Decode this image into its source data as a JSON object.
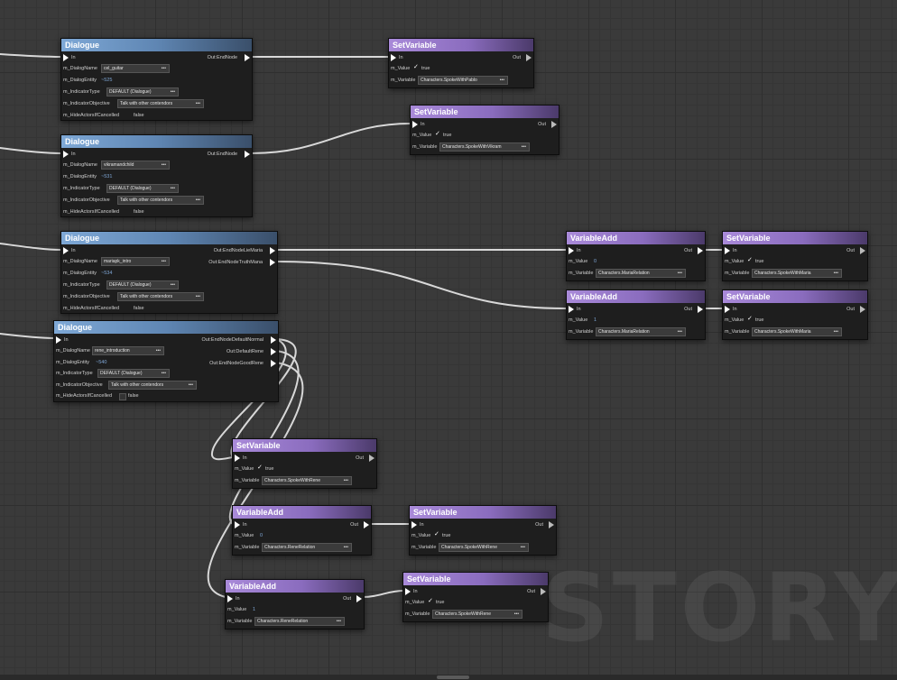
{
  "watermark": "STORY",
  "colors": {
    "dialogue_header": "#7ea8d6",
    "setvariable_header": "#a98ad9",
    "wire": "#d8d8d8",
    "canvas_bg": "#3a3a3a",
    "number_value": "#7fa7d6"
  },
  "icons": {
    "exec_pin": "triangle-pin",
    "checkbox": "check-icon"
  },
  "dialogue_nodes": [
    {
      "title": "Dialogue",
      "in_label": "In",
      "outputs": [
        "Out:EndNode"
      ],
      "dialog_name_label": "m_DialogName",
      "dialog_name": "cel_guitar",
      "dialog_entity_label": "m_DialogEntity",
      "dialog_entity": "~525",
      "indicator_type_label": "m_IndicatorType",
      "indicator_type": "DEFAULT (Dialogue)",
      "indicator_objective_label": "m_IndicatorObjective",
      "indicator_objective": "Talk with other contendors",
      "hide_actors_label": "m_HideActorsIfCancelled",
      "hide_actors": "false"
    },
    {
      "title": "Dialogue",
      "in_label": "In",
      "outputs": [
        "Out:EndNode"
      ],
      "dialog_name_label": "m_DialogName",
      "dialog_name": "vikramandchild",
      "dialog_entity_label": "m_DialogEntity",
      "dialog_entity": "~531",
      "indicator_type_label": "m_IndicatorType",
      "indicator_type": "DEFAULT (Dialogue)",
      "indicator_objective_label": "m_IndicatorObjective",
      "indicator_objective": "Talk with other contendors",
      "hide_actors_label": "m_HideActorsIfCancelled",
      "hide_actors": "false"
    },
    {
      "title": "Dialogue",
      "in_label": "In",
      "outputs": [
        "Out:EndNodeLieMaria",
        "Out:EndNodeTruthMana"
      ],
      "dialog_name_label": "m_DialogName",
      "dialog_name": "mariapk_intro",
      "dialog_entity_label": "m_DialogEntity",
      "dialog_entity": "~534",
      "indicator_type_label": "m_IndicatorType",
      "indicator_type": "DEFAULT (Dialogue)",
      "indicator_objective_label": "m_IndicatorObjective",
      "indicator_objective": "Talk with other contendors",
      "hide_actors_label": "m_HideActorsIfCancelled",
      "hide_actors": "false"
    },
    {
      "title": "Dialogue",
      "in_label": "In",
      "outputs": [
        "Out:EndNodeDefaultNormal",
        "Out:DefaultRene",
        "Out:EndNodeGoodRene"
      ],
      "dialog_name_label": "m_DialogName",
      "dialog_name": "rene_introduction",
      "dialog_entity_label": "m_DialogEntity",
      "dialog_entity": "~540",
      "indicator_type_label": "m_IndicatorType",
      "indicator_type": "DEFAULT (Dialogue)",
      "indicator_objective_label": "m_IndicatorObjective",
      "indicator_objective": "Talk with other contendors",
      "hide_actors_label": "m_HideActorsIfCancelled",
      "hide_actors": "false"
    }
  ],
  "variable_nodes": [
    {
      "kind": "setvar",
      "title": "SetVariable",
      "in_label": "In",
      "out_label": "Out",
      "value_label": "m_Value",
      "value": "true",
      "checked": true,
      "variable_label": "m_Variable",
      "variable": "Characters.SpokeWithPablo"
    },
    {
      "kind": "setvar",
      "title": "SetVariable",
      "in_label": "In",
      "out_label": "Out",
      "value_label": "m_Value",
      "value": "true",
      "checked": true,
      "variable_label": "m_Variable",
      "variable": "Characters.SpokeWithVikram"
    },
    {
      "kind": "varadd",
      "title": "VariableAdd",
      "in_label": "In",
      "out_label": "Out",
      "value_label": "m_Value",
      "value": "0",
      "checked": false,
      "variable_label": "m_Variable",
      "variable": "Characters.MariaRelation"
    },
    {
      "kind": "setvar",
      "title": "SetVariable",
      "in_label": "In",
      "out_label": "Out",
      "value_label": "m_Value",
      "value": "true",
      "checked": true,
      "variable_label": "m_Variable",
      "variable": "Characters.SpokeWithMaria"
    },
    {
      "kind": "varadd",
      "title": "VariableAdd",
      "in_label": "In",
      "out_label": "Out",
      "value_label": "m_Value",
      "value": "1",
      "checked": false,
      "variable_label": "m_Variable",
      "variable": "Characters.MariaRelation"
    },
    {
      "kind": "setvar",
      "title": "SetVariable",
      "in_label": "In",
      "out_label": "Out",
      "value_label": "m_Value",
      "value": "true",
      "checked": true,
      "variable_label": "m_Variable",
      "variable": "Characters.SpokeWithMaria"
    },
    {
      "kind": "setvar",
      "title": "SetVariable",
      "in_label": "In",
      "out_label": "Out",
      "value_label": "m_Value",
      "value": "true",
      "checked": true,
      "variable_label": "m_Variable",
      "variable": "Characters.SpokeWithRene"
    },
    {
      "kind": "varadd",
      "title": "VariableAdd",
      "in_label": "In",
      "out_label": "Out",
      "value_label": "m_Value",
      "value": "0",
      "checked": false,
      "variable_label": "m_Variable",
      "variable": "Characters.ReneRelation"
    },
    {
      "kind": "setvar",
      "title": "SetVariable",
      "in_label": "In",
      "out_label": "Out",
      "value_label": "m_Value",
      "value": "true",
      "checked": true,
      "variable_label": "m_Variable",
      "variable": "Characters.SpokeWithRene"
    },
    {
      "kind": "varadd",
      "title": "VariableAdd",
      "in_label": "In",
      "out_label": "Out",
      "value_label": "m_Value",
      "value": "1",
      "checked": false,
      "variable_label": "m_Variable",
      "variable": "Characters.ReneRelation"
    },
    {
      "kind": "setvar",
      "title": "SetVariable",
      "in_label": "In",
      "out_label": "Out",
      "value_label": "m_Value",
      "value": "true",
      "checked": true,
      "variable_label": "m_Variable",
      "variable": "Characters.SpokeWithRene"
    }
  ]
}
